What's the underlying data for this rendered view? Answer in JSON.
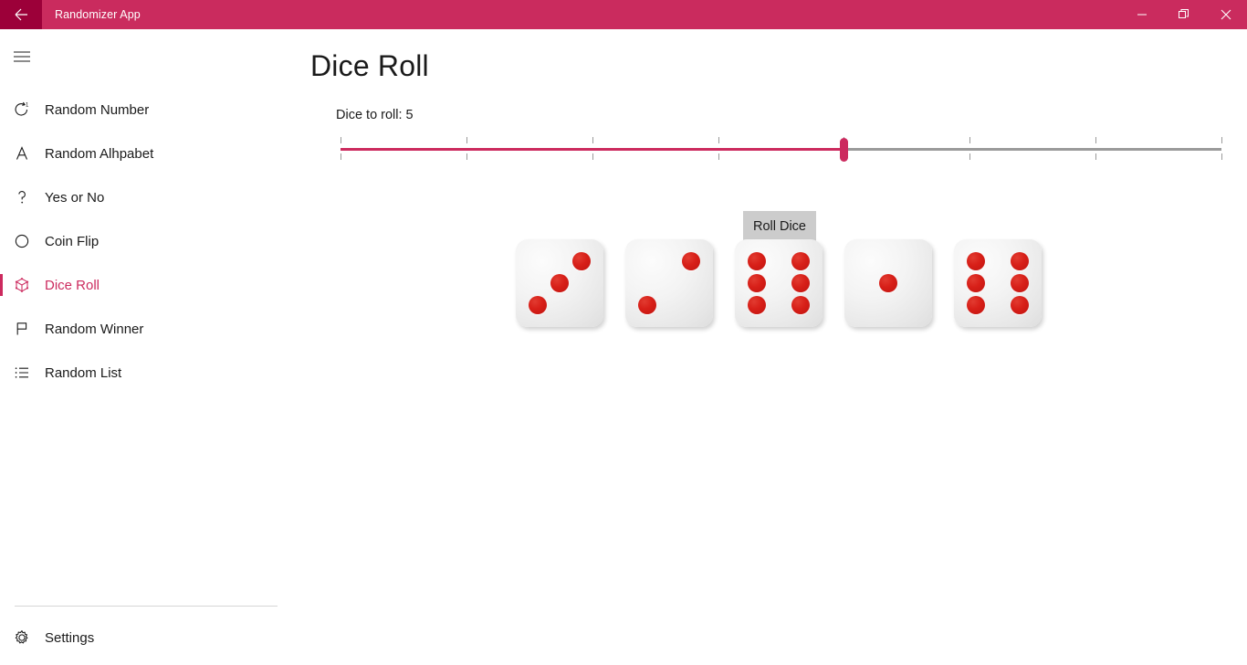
{
  "titlebar": {
    "back_icon": "back-arrow-icon",
    "app_title": "Randomizer App",
    "minimize_label": "minimize-icon",
    "restore_label": "restore-icon",
    "close_label": "close-icon"
  },
  "sidebar": {
    "menu_icon": "hamburger-icon",
    "items": [
      {
        "label": "Random Number",
        "icon": "refresh-one-icon",
        "selected": false
      },
      {
        "label": "Random Alhpabet",
        "icon": "letter-a-icon",
        "selected": false
      },
      {
        "label": "Yes or No",
        "icon": "question-mark-icon",
        "selected": false
      },
      {
        "label": "Coin Flip",
        "icon": "circle-icon",
        "selected": false
      },
      {
        "label": "Dice Roll",
        "icon": "dice-icon",
        "selected": true
      },
      {
        "label": "Random Winner",
        "icon": "flag-icon",
        "selected": false
      },
      {
        "label": "Random List",
        "icon": "list-icon",
        "selected": false
      }
    ],
    "settings": {
      "label": "Settings",
      "icon": "gear-icon"
    }
  },
  "main": {
    "page_title": "Dice Roll",
    "slider_label": "Dice to roll: 5",
    "roll_button": "Roll Dice"
  },
  "slider": {
    "min": 1,
    "max": 8,
    "value": 5,
    "tick_count": 8,
    "accent_color": "#cc2a5e",
    "track_color": "#9a9a9a"
  },
  "dice": {
    "count": 5,
    "values": [
      3,
      2,
      6,
      1,
      6
    ],
    "pip_color": "#d71f18",
    "face_color": "#f2f2f2"
  },
  "colors": {
    "titlebar": "#ca2b5e",
    "back_button": "#9c0039",
    "accent": "#cc2a5e",
    "button": "#cccccc",
    "background": "#ffffff"
  }
}
